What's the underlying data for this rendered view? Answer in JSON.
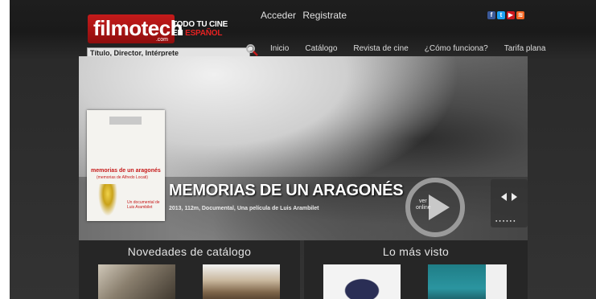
{
  "header": {
    "logo_text": "filmotech",
    "logo_suffix": ".com",
    "tagline_line1": "TODO TU CINE",
    "tagline_line2_white": "EN",
    "tagline_line2_red": "ESPAÑOL",
    "login_label": "Acceder",
    "register_label": "Registrate"
  },
  "search": {
    "placeholder": "Título, Director, Intérprete"
  },
  "nav": {
    "items": [
      {
        "label": "Inicio"
      },
      {
        "label": "Catálogo"
      },
      {
        "label": "Revista de cine"
      },
      {
        "label": "¿Cómo funciona?"
      },
      {
        "label": "Tarifa plana"
      }
    ]
  },
  "hero": {
    "title": "MEMORIAS DE UN ARAGONÉS",
    "meta": "2013, 112m, Documental, Una película de Luis Arambilet",
    "poster": {
      "title": "memorias de un aragonés",
      "subtitle": "(memorias de Alfredo Locati)",
      "credit_line1": "Un documental de",
      "credit_line2": "Luis Arambilet"
    },
    "play_label_line1": "ver",
    "play_label_line2": "online"
  },
  "sections": {
    "left_title": "Novedades de catálogo",
    "right_title": "Lo más visto"
  },
  "colors": {
    "brand_red": "#c41a1a",
    "nav_active": "#c21414",
    "facebook": "#3b5998",
    "twitter": "#1da1f2",
    "youtube": "#cc181e",
    "rss": "#f26522"
  },
  "icons": {
    "social": [
      "facebook-icon",
      "twitter-icon",
      "youtube-icon",
      "rss-icon"
    ],
    "search": "search-icon",
    "play": "play-icon",
    "arrows": "prev-next-arrows-icon"
  }
}
